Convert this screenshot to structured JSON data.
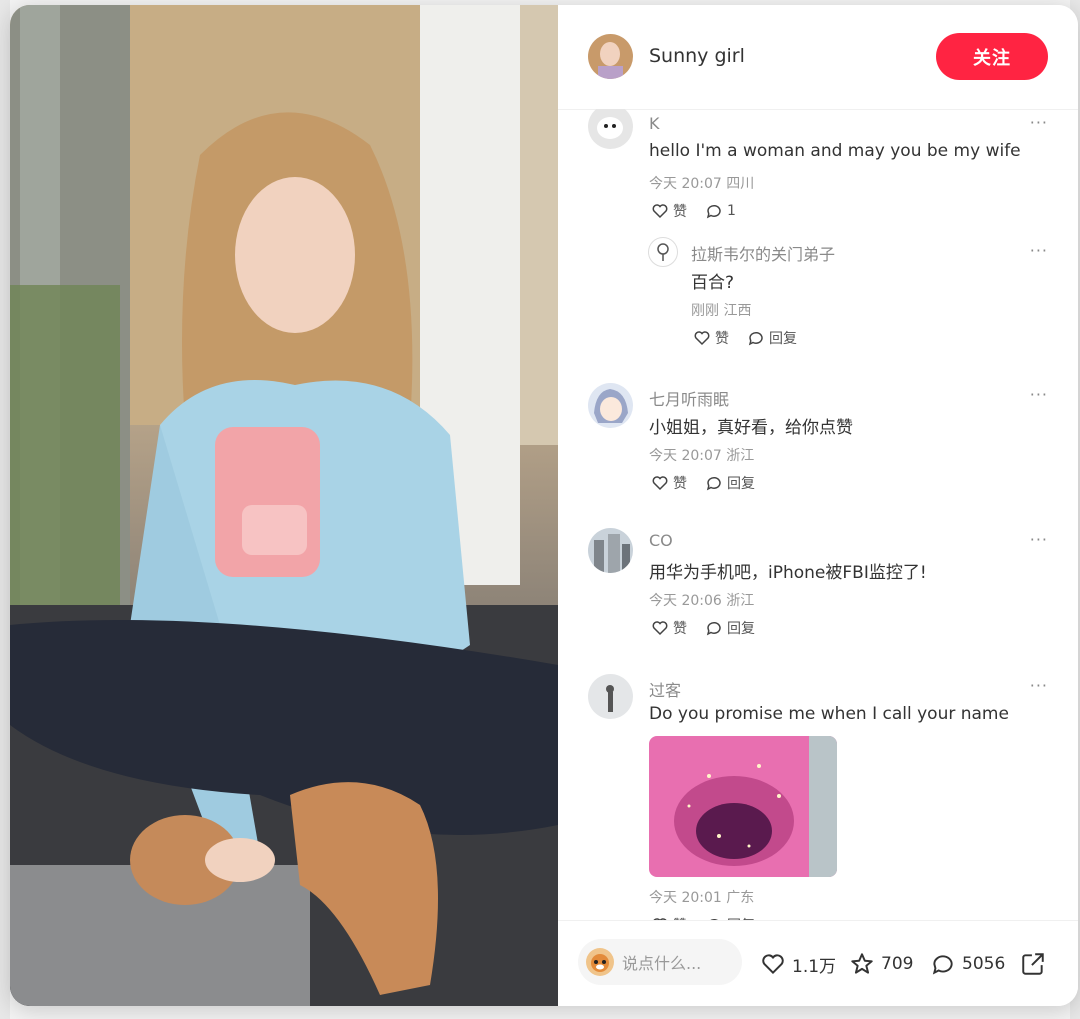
{
  "author": {
    "name": "Sunny girl"
  },
  "follow_label": "关注",
  "comments": [
    {
      "user": "K",
      "text": "hello I'm a woman and may you be my wife",
      "meta": "今天 20:07 四川",
      "like": "赞",
      "reply": "1"
    },
    {
      "user": "拉斯韦尔的关门弟子",
      "text": "百合?",
      "meta": "刚刚 江西",
      "like": "赞",
      "reply": "回复"
    },
    {
      "user": "七月听雨眠",
      "text": "小姐姐，真好看，给你点赞",
      "meta": "今天 20:07 浙江",
      "like": "赞",
      "reply": "回复"
    },
    {
      "user": "CO",
      "text": "用华为手机吧，iPhone被FBI监控了!",
      "meta": "今天 20:06 浙江",
      "like": "赞",
      "reply": "回复"
    },
    {
      "user": "过客",
      "text": "Do you promise me when I call your name",
      "meta": "今天 20:01 广东",
      "like": "赞",
      "reply": "回复"
    }
  ],
  "more_label": "···",
  "footer": {
    "input_placeholder": "说点什么...",
    "likes": "1.1万",
    "collects": "709",
    "comment_count": "5056"
  },
  "icons": [
    "heart-icon",
    "star-icon",
    "comment-icon",
    "share-icon",
    "more-icon"
  ]
}
